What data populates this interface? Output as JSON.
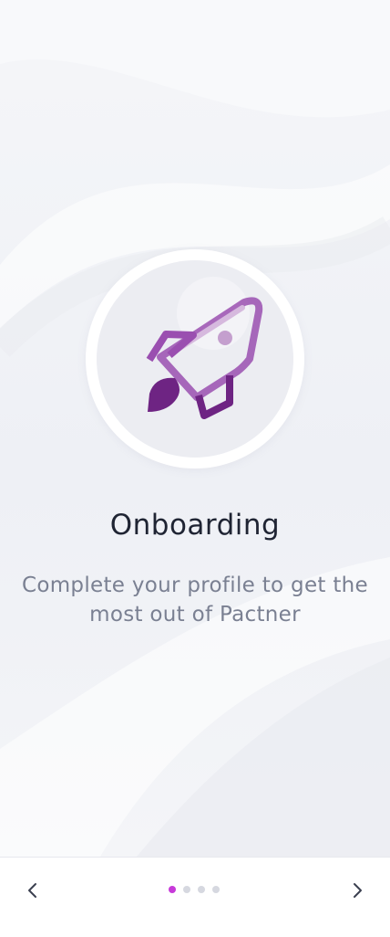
{
  "onboarding": {
    "title": "Onboarding",
    "subtitle": "Complete your profile to get the most out of Pactner",
    "hero_icon": "rocket-icon"
  },
  "pager": {
    "total_pages": 4,
    "current_page": 1,
    "prev_icon": "chevron-left-icon",
    "next_icon": "chevron-right-icon"
  },
  "colors": {
    "accent": "#c73ad9",
    "rocket_dark": "#6e2483",
    "rocket_mid": "#9a4fb0",
    "rocket_light": "#d6b9de",
    "title": "#1f2433",
    "subtitle": "#7a8092",
    "dot_inactive": "#d6d8e0",
    "chevron": "#3a3f4f"
  }
}
